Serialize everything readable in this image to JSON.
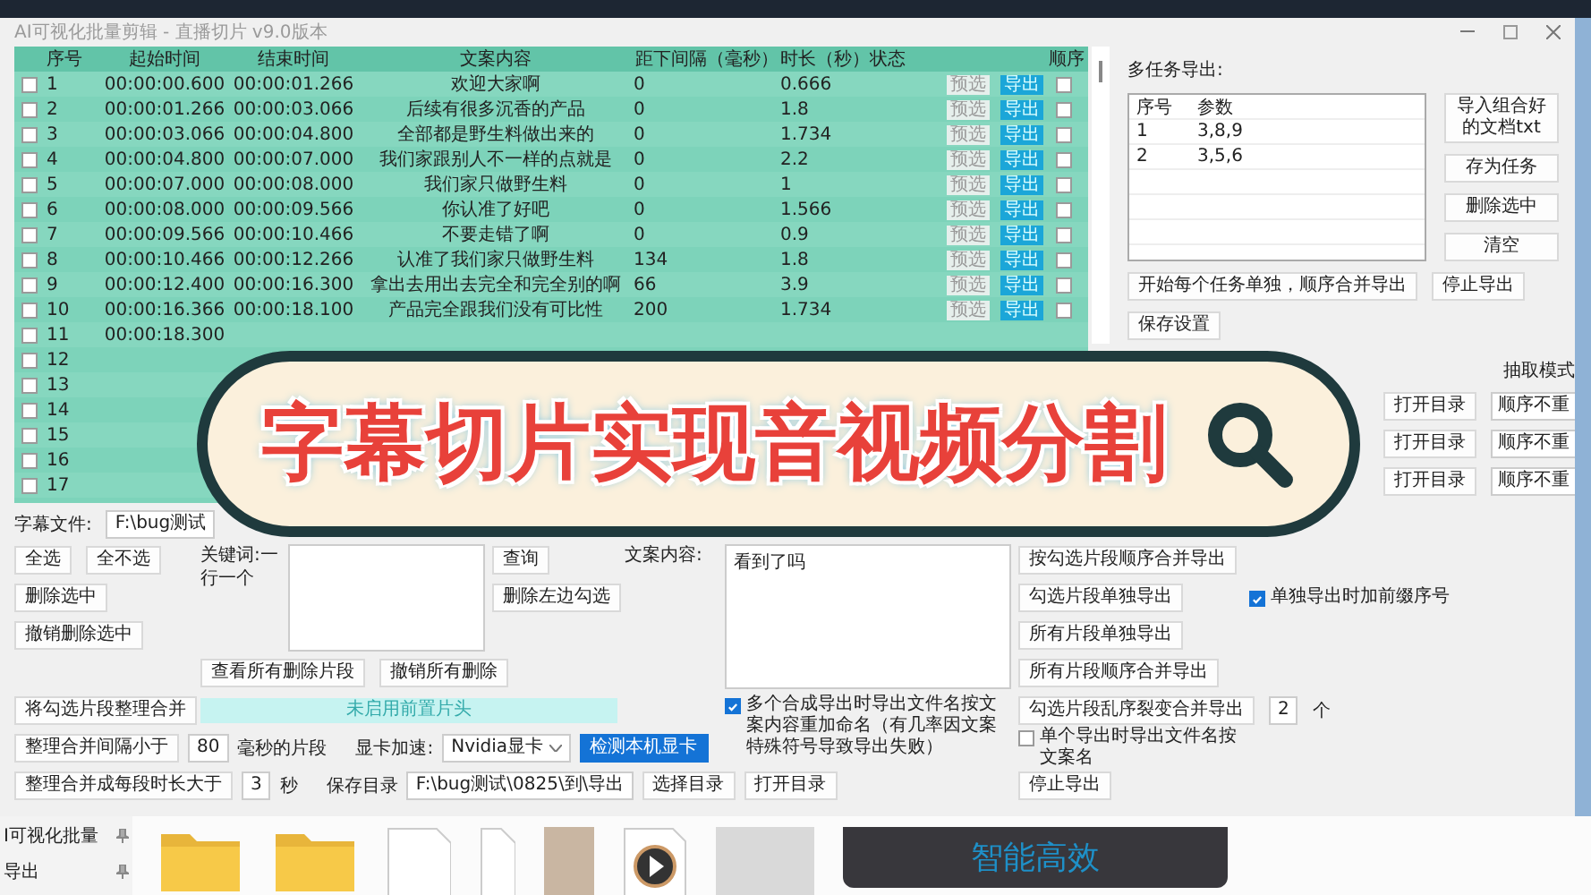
{
  "window": {
    "title": "AI可视化批量剪辑 - 直播切片 v9.0版本"
  },
  "table": {
    "columns": [
      "序号",
      "起始时间",
      "结束时间",
      "文案内容",
      "距下间隔（毫秒）",
      "时长（秒）",
      "状态",
      "顺序"
    ],
    "rows": [
      {
        "no": "1",
        "start": "00:00:00.600",
        "end": "00:00:01.266",
        "text": "欢迎大家啊",
        "gap": "0",
        "duration": "0.666",
        "preview": "预选",
        "export": "导出",
        "checked": false,
        "order_checked": false
      },
      {
        "no": "2",
        "start": "00:00:01.266",
        "end": "00:00:03.066",
        "text": "后续有很多沉香的产品",
        "gap": "0",
        "duration": "1.8",
        "preview": "预选",
        "export": "导出",
        "checked": false,
        "order_checked": false
      },
      {
        "no": "3",
        "start": "00:00:03.066",
        "end": "00:00:04.800",
        "text": "全部都是野生料做出来的",
        "gap": "0",
        "duration": "1.734",
        "preview": "预选",
        "export": "导出",
        "checked": false,
        "order_checked": false
      },
      {
        "no": "4",
        "start": "00:00:04.800",
        "end": "00:00:07.000",
        "text": "我们家跟别人不一样的点就是",
        "gap": "0",
        "duration": "2.2",
        "preview": "预选",
        "export": "导出",
        "checked": false,
        "order_checked": false
      },
      {
        "no": "5",
        "start": "00:00:07.000",
        "end": "00:00:08.000",
        "text": "我们家只做野生料",
        "gap": "0",
        "duration": "1",
        "preview": "预选",
        "export": "导出",
        "checked": false,
        "order_checked": false
      },
      {
        "no": "6",
        "start": "00:00:08.000",
        "end": "00:00:09.566",
        "text": "你认准了好吧",
        "gap": "0",
        "duration": "1.566",
        "preview": "预选",
        "export": "导出",
        "checked": false,
        "order_checked": false
      },
      {
        "no": "7",
        "start": "00:00:09.566",
        "end": "00:00:10.466",
        "text": "不要走错了啊",
        "gap": "0",
        "duration": "0.9",
        "preview": "预选",
        "export": "导出",
        "checked": false,
        "order_checked": false
      },
      {
        "no": "8",
        "start": "00:00:10.466",
        "end": "00:00:12.266",
        "text": "认准了我们家只做野生料",
        "gap": "134",
        "duration": "1.8",
        "preview": "预选",
        "export": "导出",
        "checked": false,
        "order_checked": false
      },
      {
        "no": "9",
        "start": "00:00:12.400",
        "end": "00:00:16.300",
        "text": "拿出去用出去完全和完全别的啊",
        "gap": "66",
        "duration": "3.9",
        "preview": "预选",
        "export": "导出",
        "checked": false,
        "order_checked": false
      },
      {
        "no": "10",
        "start": "00:00:16.366",
        "end": "00:00:18.100",
        "text": "产品完全跟我们没有可比性",
        "gap": "200",
        "duration": "1.734",
        "preview": "预选",
        "export": "导出",
        "checked": false,
        "order_checked": false
      },
      {
        "no": "11",
        "start": "00:00:18.300",
        "checked": false
      },
      {
        "no": "12",
        "checked": false
      },
      {
        "no": "13",
        "checked": false
      },
      {
        "no": "14",
        "checked": false
      },
      {
        "no": "15",
        "checked": false
      },
      {
        "no": "16",
        "checked": false
      },
      {
        "no": "17",
        "checked": false
      }
    ]
  },
  "multi_task": {
    "label": "多任务导出:",
    "columns": [
      "序号",
      "参数"
    ],
    "rows": [
      [
        "1",
        "3,8,9"
      ],
      [
        "2",
        "3,5,6"
      ]
    ],
    "side_buttons": [
      "导入组合好的文档txt",
      "存为任务",
      "删除选中",
      "清空"
    ],
    "start_button": "开始每个任务单独，顺序合并导出",
    "stop_button": "停止导出",
    "save_button": "保存设置"
  },
  "extract": {
    "label": "抽取模式",
    "rows": [
      {
        "button": "打开目录",
        "mode": "顺序不重"
      },
      {
        "button": "打开目录",
        "mode": "顺序不重"
      },
      {
        "button": "打开目录",
        "mode": "顺序不重"
      }
    ]
  },
  "subtitle_file": {
    "label": "字幕文件:",
    "value": "F:\\bug测试"
  },
  "select_buttons": [
    "全选",
    "全不选"
  ],
  "delete_selected": "删除选中",
  "undo_delete": "撤销删除选中",
  "merge_button": "将勾选片段整理合并",
  "keywords": {
    "label": "关键词:一行一个"
  },
  "query_button": "查询",
  "delete_left_button": "删除左边勾选",
  "view_deleted_button": "查看所有删除片段",
  "undo_all_button": "撤销所有删除",
  "intro_bar": "未启用前置片头",
  "merge_gap": {
    "button": "整理合并间隔小于",
    "value": "80",
    "unit": "毫秒的片段"
  },
  "gpu": {
    "label": "显卡加速:",
    "value": "Nvidia显卡",
    "detect_button": "检测本机显卡"
  },
  "merge_min": {
    "button": "整理合并成每段时长大于",
    "value": "3",
    "unit": "秒"
  },
  "save_dir": {
    "label": "保存目录",
    "value": "F:\\bug测试\\0825\\到\\导出",
    "choose_button": "选择目录",
    "open_button": "打开目录"
  },
  "copy": {
    "label": "文案内容:",
    "value": "看到了吗"
  },
  "export_buttons": [
    "按勾选片段顺序合并导出",
    "勾选片段单独导出",
    "所有片段单独导出",
    "所有片段顺序合并导出"
  ],
  "rename_option": {
    "label": "多个合成导出时导出文件名按文案内容重加命名（有几率因文案特殊符号导致导出失败）",
    "checked": true
  },
  "shuffle": {
    "button": "勾选片段乱序裂变合并导出",
    "value": "2",
    "unit": "个"
  },
  "single_name_option": {
    "label": "单个导出时导出文件名按文案名",
    "checked": false
  },
  "stop_button": "停止导出",
  "prefix_option": {
    "label": "单独导出时加前缀序号",
    "checked": true
  },
  "banner": {
    "text": "字幕切片实现音视频分割"
  },
  "quick_access": [
    {
      "label": "I可视化批量"
    },
    {
      "label": "导出"
    }
  ],
  "promo_card": {
    "text": "智能高效"
  }
}
